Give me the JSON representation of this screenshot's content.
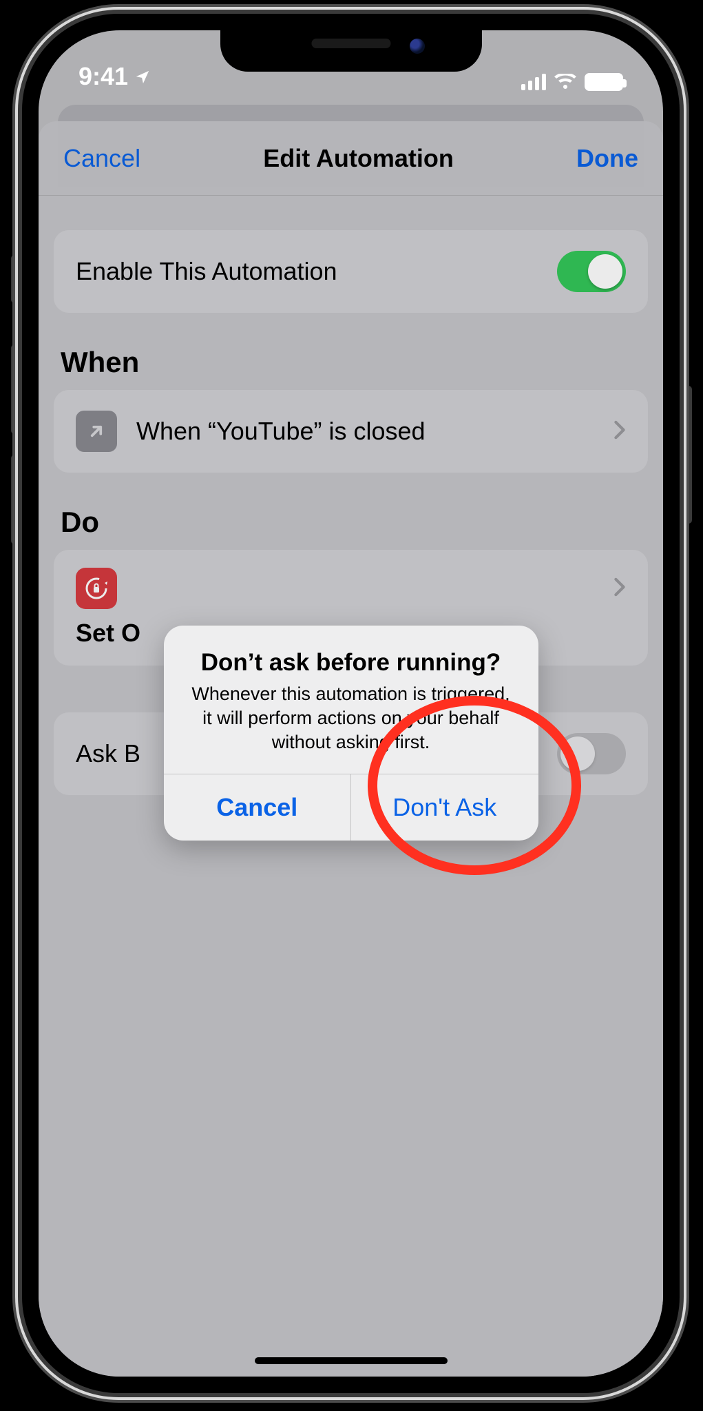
{
  "status": {
    "time": "9:41"
  },
  "nav": {
    "cancel": "Cancel",
    "title": "Edit Automation",
    "done": "Done"
  },
  "enable": {
    "label": "Enable This Automation",
    "on": true
  },
  "sections": {
    "when": "When",
    "do": "Do"
  },
  "trigger": {
    "label": "When “YouTube” is closed"
  },
  "action": {
    "title_visible": "Set O"
  },
  "ask": {
    "label_visible": "Ask B",
    "on": false
  },
  "alert": {
    "title": "Don’t ask before running?",
    "message": "Whenever this automation is triggered, it will perform actions on your behalf without asking first.",
    "cancel": "Cancel",
    "confirm": "Don't Ask"
  }
}
